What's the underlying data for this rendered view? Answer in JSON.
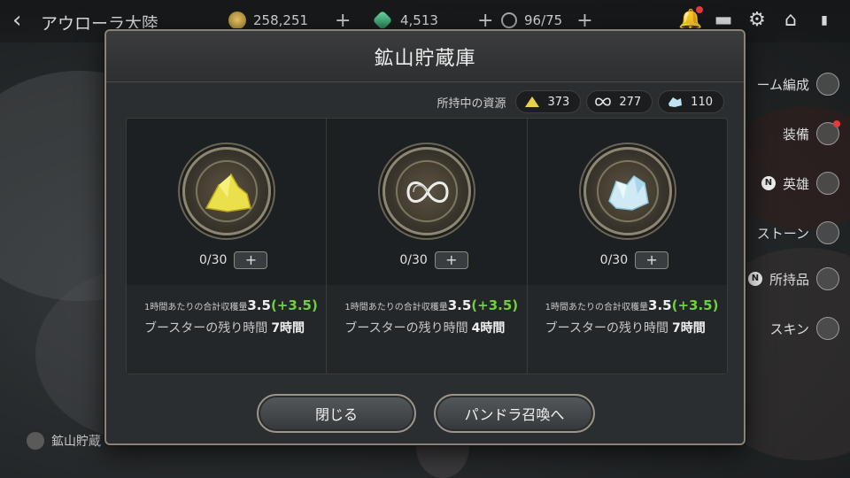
{
  "top_bar": {
    "back_icon": "chevron-left",
    "region": "アウローラ大陸",
    "resources": [
      {
        "icon": "gold-coin-icon",
        "value": "258,251",
        "color": "#c9a24a"
      },
      {
        "icon": "green-gem-icon",
        "value": "4,513",
        "color": "#3fb07a"
      },
      {
        "icon": "stamina-icon",
        "value": "96/75",
        "color": "#b0b0b0"
      }
    ],
    "add_label": "+"
  },
  "side_menu": [
    {
      "label": "ーム編成",
      "badge": ""
    },
    {
      "label": "装備",
      "badge": ""
    },
    {
      "label": "英雄",
      "badge": "N"
    },
    {
      "label": "ストーン",
      "badge": ""
    },
    {
      "label": "所持品",
      "badge": "N"
    },
    {
      "label": "スキン",
      "badge": ""
    }
  ],
  "bottom_left": {
    "label": "鉱山貯蔵"
  },
  "modal": {
    "title": "鉱山貯蔵庫",
    "owned_label": "所持中の資源",
    "owned": [
      {
        "icon": "gold-ore-icon",
        "value": "373"
      },
      {
        "icon": "infinity-ore-icon",
        "value": "277"
      },
      {
        "icon": "crystal-ore-icon",
        "value": "110"
      }
    ],
    "mines": [
      {
        "icon": "gold-ore-icon",
        "count": "0/30",
        "rate_label": "1時間あたりの合計収穫量",
        "rate": "3.5",
        "bonus": "(+3.5)",
        "booster_label": "ブースターの残り時間",
        "booster_time": "7時間"
      },
      {
        "icon": "infinity-ore-icon",
        "count": "0/30",
        "rate_label": "1時間あたりの合計収穫量",
        "rate": "3.5",
        "bonus": "(+3.5)",
        "booster_label": "ブースターの残り時間",
        "booster_time": "4時間"
      },
      {
        "icon": "crystal-ore-icon",
        "count": "0/30",
        "rate_label": "1時間あたりの合計収穫量",
        "rate": "3.5",
        "bonus": "(+3.5)",
        "booster_label": "ブースターの残り時間",
        "booster_time": "7時間"
      }
    ],
    "plus_label": "+",
    "close_label": "閉じる",
    "summon_label": "パンドラ召喚へ"
  },
  "colors": {
    "bonus_green": "#6fd13a",
    "frame_gold": "#8a8478"
  }
}
